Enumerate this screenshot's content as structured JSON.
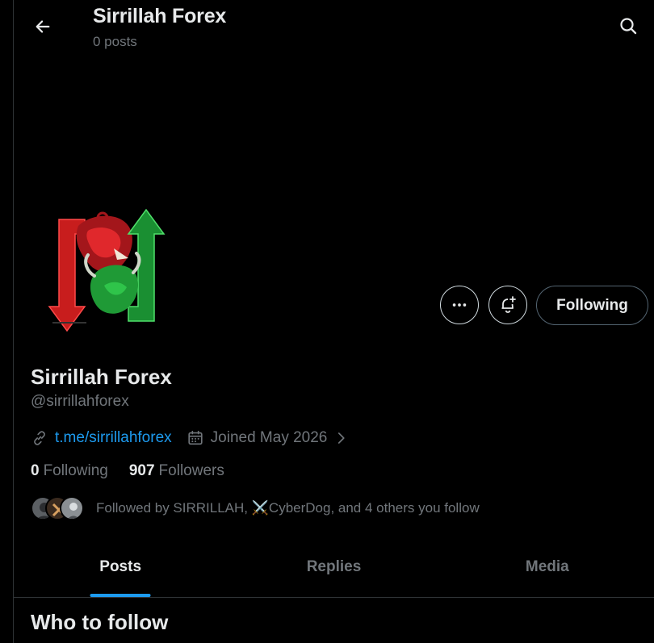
{
  "header": {
    "title": "Sirrillah Forex",
    "subtitle": "0 posts",
    "back_icon": "arrow-left-icon",
    "search_icon": "search-icon"
  },
  "profile": {
    "display_name": "Sirrillah Forex",
    "handle": "@sirrillahforex",
    "link": "t.me/sirrillahforex",
    "joined": "Joined May 2026",
    "following_count": "0",
    "following_label": "Following",
    "followers_count": "907",
    "followers_label": "Followers",
    "followed_by": "Followed by SIRRILLAH, ⚔️CyberDog, and 4 others you follow"
  },
  "actions": {
    "more_icon": "more-icon",
    "notify_icon": "bell-plus-icon",
    "following_button": "Following"
  },
  "tabs": [
    {
      "label": "Posts",
      "active": true
    },
    {
      "label": "Replies",
      "active": false
    },
    {
      "label": "Media",
      "active": false
    }
  ],
  "section": {
    "who_to_follow": "Who to follow"
  },
  "colors": {
    "accent": "#1d9bf0",
    "background": "#000000",
    "muted": "#71767b",
    "bear_red": "#d42020",
    "bull_green": "#1e9e3a"
  }
}
